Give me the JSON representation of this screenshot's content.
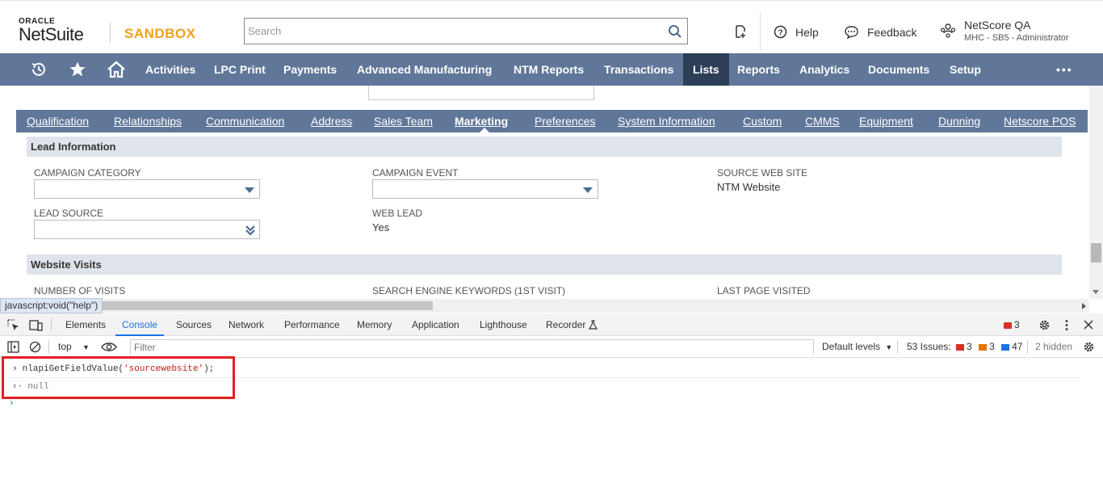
{
  "header": {
    "logo_top": "ORACLE",
    "logo_main": "NetSuite",
    "environment": "SANDBOX",
    "search_placeholder": "Search",
    "help_label": "Help",
    "feedback_label": "Feedback",
    "user_name": "NetScore QA",
    "user_role": "MHC - SB5 - Administrator"
  },
  "nav": {
    "items": [
      "Activities",
      "LPC Print",
      "Payments",
      "Advanced Manufacturing",
      "NTM Reports",
      "Transactions",
      "Lists",
      "Reports",
      "Analytics",
      "Documents",
      "Setup"
    ],
    "active": "Lists",
    "more": "•••"
  },
  "subtabs": {
    "items": [
      "Qualification",
      "Relationships",
      "Communication",
      "Address",
      "Sales Team",
      "Marketing",
      "Preferences",
      "System Information",
      "Custom",
      "CMMS",
      "Equipment",
      "Dunning",
      "Netscore POS"
    ],
    "active": "Marketing"
  },
  "lead_information": {
    "title": "Lead Information",
    "campaign_category_label": "CAMPAIGN CATEGORY",
    "campaign_event_label": "CAMPAIGN EVENT",
    "source_web_site_label": "SOURCE WEB SITE",
    "source_web_site_value": "NTM Website",
    "lead_source_label": "LEAD SOURCE",
    "web_lead_label": "WEB LEAD",
    "web_lead_value": "Yes"
  },
  "website_visits": {
    "title": "Website Visits",
    "number_of_visits_label": "NUMBER OF VISITS",
    "search_engine_keywords_label": "SEARCH ENGINE KEYWORDS (1ST VISIT)",
    "last_page_visited_label": "LAST PAGE VISITED"
  },
  "statusbar": {
    "text": "javascript:void(\"help\")"
  },
  "devtools": {
    "tabs": [
      "Elements",
      "Console",
      "Sources",
      "Network",
      "Performance",
      "Memory",
      "Application",
      "Lighthouse",
      "Recorder"
    ],
    "active_tab": "Console",
    "error_count": "3",
    "context": "top",
    "filter_placeholder": "Filter",
    "default_levels": "Default levels",
    "issues_label": "53 Issues:",
    "issues_errors": "3",
    "issues_warnings": "3",
    "issues_info": "47",
    "hidden": "2 hidden"
  },
  "console": {
    "input_fn": "nlapiGetFieldValue(",
    "input_arg": "'sourcewebsite'",
    "input_end": ");",
    "result": "null"
  },
  "colors": {
    "nav_bg": "#607799",
    "nav_active": "#2d3e57",
    "sandbox": "#f0a01e",
    "highlight": "#e02020",
    "devtools_accent": "#1a73e8"
  }
}
